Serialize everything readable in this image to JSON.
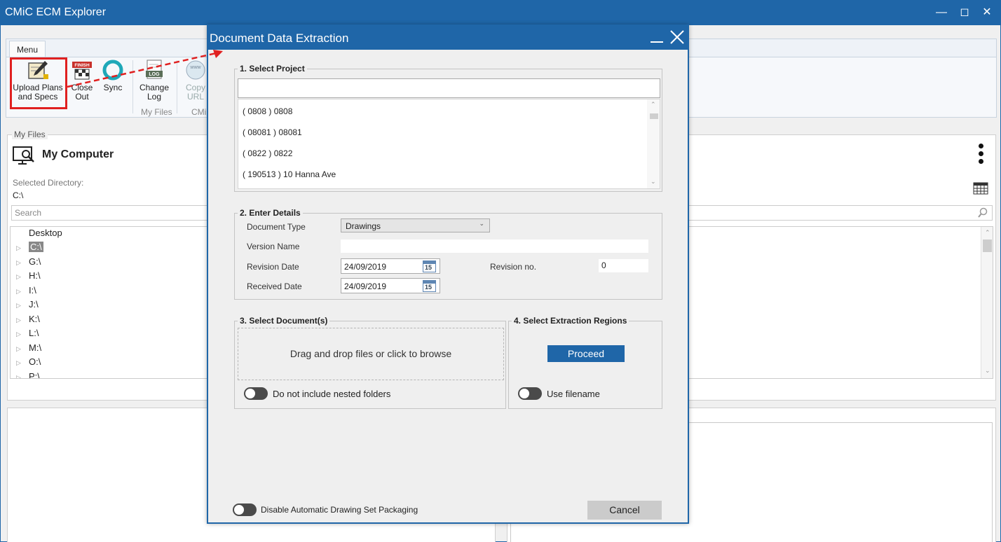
{
  "window": {
    "title": "CMiC ECM Explorer"
  },
  "ribbon": {
    "menu_tab": "Menu",
    "buttons": {
      "upload_l1": "Upload Plans",
      "upload_l2": "and Specs",
      "close_l1": "Close",
      "close_l2": "Out",
      "sync": "Sync",
      "change_l1": "Change",
      "change_l2": "Log",
      "copy_l1": "Copy",
      "copy_l2": "URL"
    },
    "group_labels": {
      "my_files": "My Files",
      "cmic": "CMi"
    },
    "icon_text": {
      "finish": "FINISH",
      "log": "LOG",
      "www": "www"
    }
  },
  "myfiles": {
    "legend": "My Files",
    "title": "My Computer",
    "selected_dir_label": "Selected Directory:",
    "selected_dir_value": "C:\\",
    "search_placeholder": "Search",
    "tree": [
      "Desktop",
      "C:\\",
      "G:\\",
      "H:\\",
      "I:\\",
      "J:\\",
      "K:\\",
      "L:\\",
      "M:\\",
      "O:\\",
      "P:\\"
    ]
  },
  "dialog": {
    "title": "Document Data Extraction",
    "s1": {
      "legend": "1. Select Project",
      "search_value": "",
      "projects": [
        "( 0808 ) 0808",
        "( 08081 ) 08081",
        "( 0822 ) 0822",
        "( 190513 ) 10 Hanna Ave"
      ]
    },
    "s2": {
      "legend": "2. Enter Details",
      "doc_type_label": "Document Type",
      "doc_type_value": "Drawings",
      "version_label": "Version Name",
      "version_value": "",
      "rev_date_label": "Revision Date",
      "rev_date_value": "24/09/2019",
      "rev_no_label": "Revision no.",
      "rev_no_value": "0",
      "recv_date_label": "Received Date",
      "recv_date_value": "24/09/2019",
      "cal_day": "15"
    },
    "s3": {
      "legend": "3. Select Document(s)",
      "dropzone": "Drag and drop files or click to browse",
      "nested_toggle": "Do not include nested folders"
    },
    "s4": {
      "legend": "4. Select Extraction Regions",
      "proceed": "Proceed",
      "filename_toggle": "Use filename"
    },
    "disable_toggle": "Disable Automatic Drawing Set Packaging",
    "cancel": "Cancel"
  }
}
